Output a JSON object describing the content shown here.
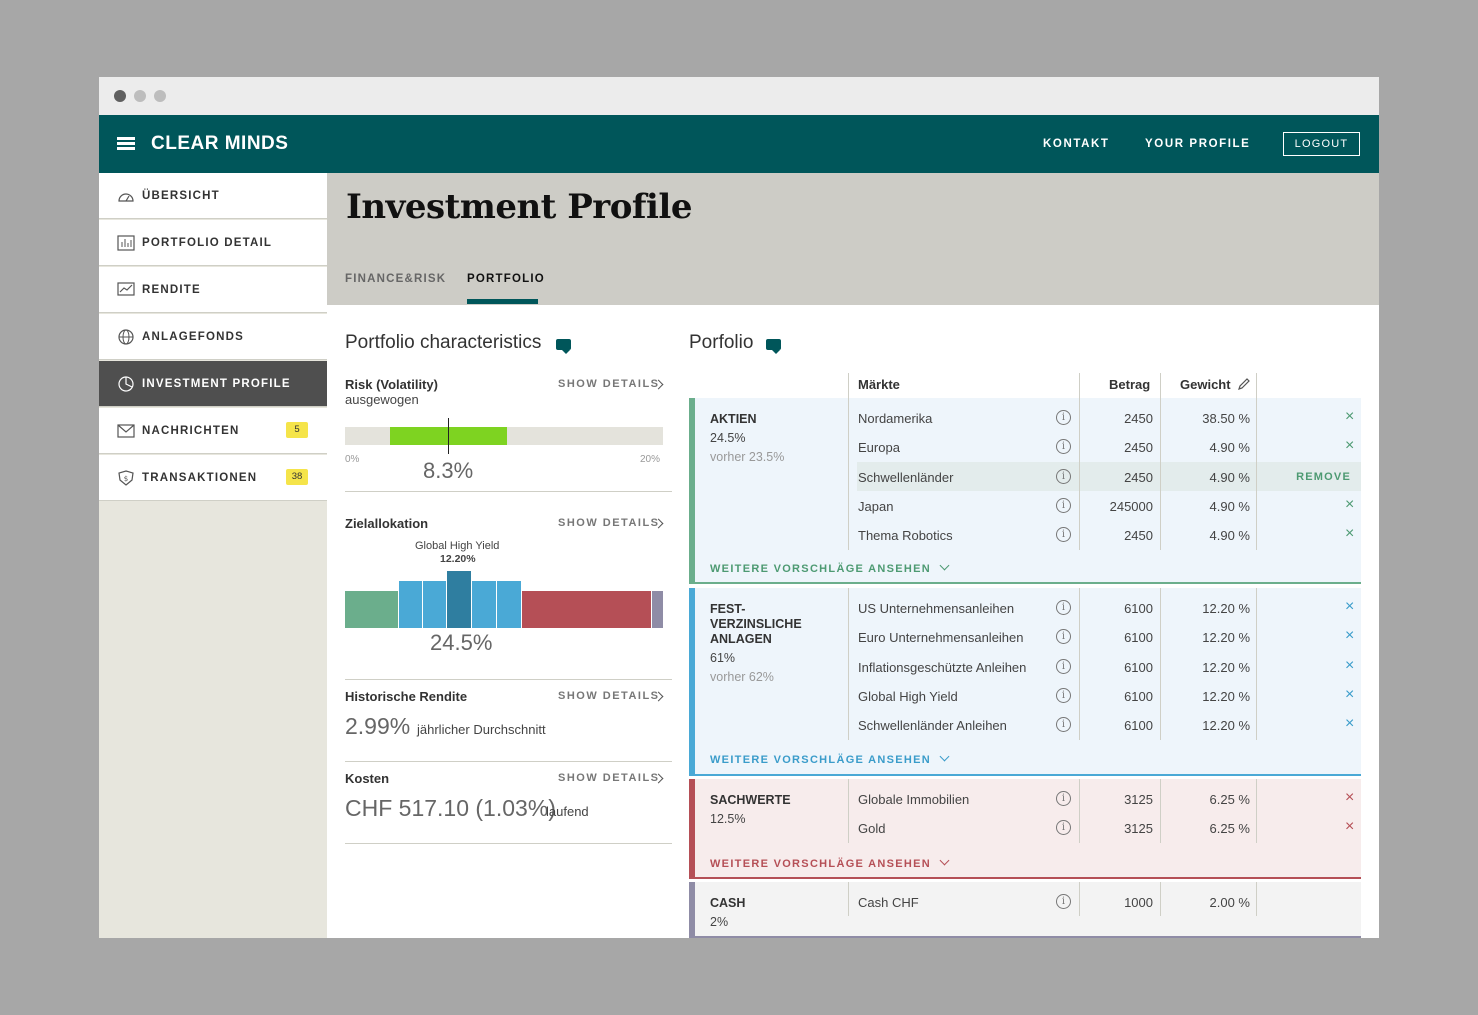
{
  "topnav": {
    "brand": "CLEAR MINDS",
    "kontakt": "KONTAKT",
    "profile": "YOUR PROFILE",
    "logout": "LOGOUT"
  },
  "sidebar": {
    "items": [
      {
        "label": "ÜBERSICHT",
        "icon": "gauge-icon"
      },
      {
        "label": "PORTFOLIO DETAIL",
        "icon": "chart-icon"
      },
      {
        "label": "RENDITE",
        "icon": "trend-icon"
      },
      {
        "label": "ANLAGEFONDS",
        "icon": "globe-icon"
      },
      {
        "label": "INVESTMENT PROFILE",
        "icon": "pie-icon",
        "active": true
      },
      {
        "label": "NACHRICHTEN",
        "icon": "mail-icon",
        "badge": "5"
      },
      {
        "label": "TRANSAKTIONEN",
        "icon": "shield-icon",
        "badge": "38"
      }
    ]
  },
  "header": {
    "title": "Investment Profile",
    "tabs": [
      {
        "label": "FINANCE&RISK"
      },
      {
        "label": "PORTFOLIO",
        "active": true
      }
    ]
  },
  "characteristics": {
    "title": "Portfolio characteristics",
    "show_details": "SHOW DETAILS",
    "risk": {
      "label": "Risk (Volatility)",
      "sub": "ausgewogen",
      "value": "8.3%",
      "min": "0%",
      "max": "20%",
      "range_fraction": [
        0.14,
        0.51
      ],
      "marker_fraction": 0.325
    },
    "ziel": {
      "label": "Zielallokation",
      "hover": "Global High Yield",
      "hover_value": "12.20%",
      "value": "24.5%"
    },
    "rendite": {
      "label": "Historische Rendite",
      "value": "2.99%",
      "suffix": "jährlicher Durchschnitt"
    },
    "kosten": {
      "label": "Kosten",
      "value": "CHF 517.10 (1.03%)",
      "suffix": "laufend"
    }
  },
  "portfolio": {
    "title": "Porfolio",
    "columns": {
      "maerkte": "Märkte",
      "betrag": "Betrag",
      "gewicht": "Gewicht"
    },
    "more": "WEITERE VORSCHLÄGE ANSEHEN",
    "remove": "REMOVE",
    "info_glyph": "i",
    "close_glyph": "×",
    "groups": [
      {
        "name": "AKTIEN",
        "pct": "24.5%",
        "prev": "vorher 23.5%",
        "color": "#6bae8c",
        "bg": "#eef5fb",
        "rows": [
          {
            "market": "Nordamerika",
            "amount": "2450",
            "weight": "38.50 %"
          },
          {
            "market": "Europa",
            "amount": "2450",
            "weight": "4.90 %"
          },
          {
            "market": "Schwellenländer",
            "amount": "2450",
            "weight": "4.90 %",
            "highlight": true
          },
          {
            "market": "Japan",
            "amount": "245000",
            "weight": "4.90 %"
          },
          {
            "market": "Thema Robotics",
            "amount": "2450",
            "weight": "4.90 %"
          }
        ]
      },
      {
        "name": "FEST-VERZINSLICHE ANLAGEN",
        "name_lines": [
          "FEST-",
          "VERZINSLICHE",
          "ANLAGEN"
        ],
        "pct": "61%",
        "prev": "vorher 62%",
        "color": "#4aa9d6",
        "bg": "#eef5fb",
        "rows": [
          {
            "market": "US Unternehmensanleihen",
            "amount": "6100",
            "weight": "12.20 %"
          },
          {
            "market": "Euro Unternehmensanleihen",
            "amount": "6100",
            "weight": "12.20 %"
          },
          {
            "market": "Inflationsgeschützte Anleihen",
            "amount": "6100",
            "weight": "12.20 %"
          },
          {
            "market": "Global High Yield",
            "amount": "6100",
            "weight": "12.20 %"
          },
          {
            "market": "Schwellenländer Anleihen",
            "amount": "6100",
            "weight": "12.20 %"
          }
        ]
      },
      {
        "name": "SACHWERTE",
        "pct": "12.5%",
        "color": "#b54f56",
        "bg": "#f7ecec",
        "rows": [
          {
            "market": "Globale Immobilien",
            "amount": "3125",
            "weight": "6.25 %"
          },
          {
            "market": "Gold",
            "amount": "3125",
            "weight": "6.25 %"
          }
        ]
      },
      {
        "name": "CASH",
        "pct": "2%",
        "color": "#8f8ca6",
        "bg": "#f3f3f3",
        "rows": [
          {
            "market": "Cash CHF",
            "amount": "1000",
            "weight": "2.00 %"
          }
        ]
      }
    ]
  },
  "colors": {
    "primary": "#00565a",
    "badge": "#f5e44a",
    "risk_green": "#7ed321"
  }
}
